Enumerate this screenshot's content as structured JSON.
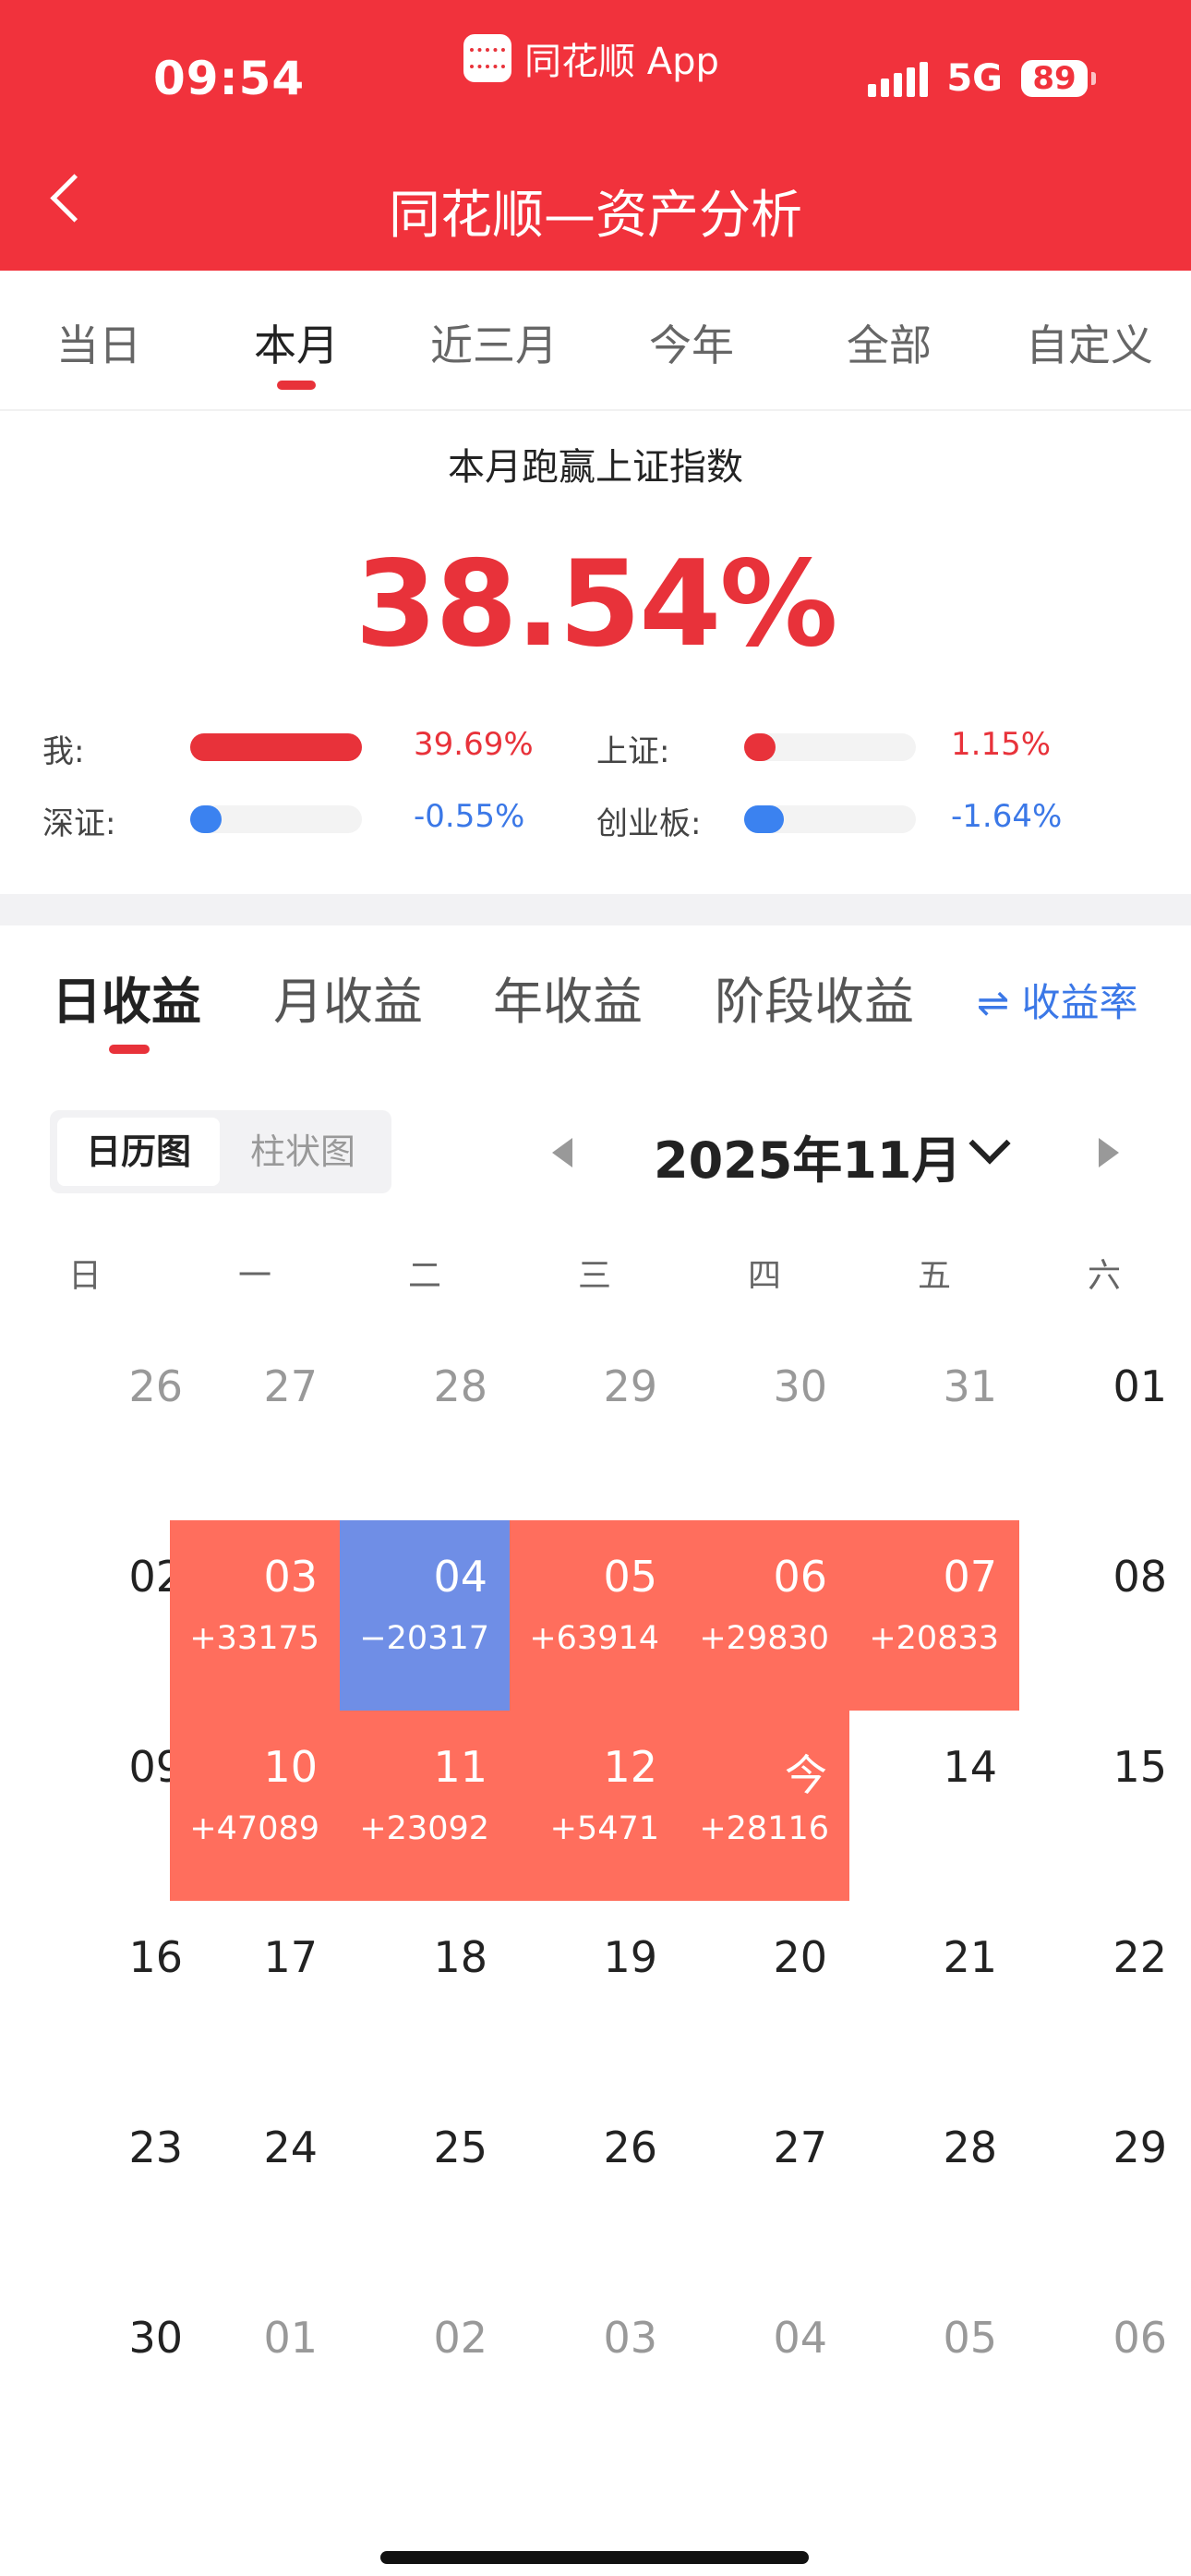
{
  "status_bar": {
    "time": "09:54",
    "app_name": "同花顺 App",
    "network": "5G",
    "battery": "89"
  },
  "header": {
    "title": "同花顺—资产分析"
  },
  "period_tabs": [
    {
      "label": "当日",
      "active": false
    },
    {
      "label": "本月",
      "active": true
    },
    {
      "label": "近三月",
      "active": false
    },
    {
      "label": "今年",
      "active": false
    },
    {
      "label": "全部",
      "active": false
    },
    {
      "label": "自定义",
      "active": false
    }
  ],
  "summary": {
    "title": "本月跑赢上证指数",
    "value": "38.54%",
    "comparisons": [
      {
        "label": "我:",
        "value": "39.69%",
        "fill": 1.0,
        "color": "#e8323a"
      },
      {
        "label": "上证:",
        "value": "1.15%",
        "fill": 0.18,
        "color": "#e8323a"
      },
      {
        "label": "深证:",
        "value": "-0.55%",
        "fill": 0.12,
        "color": "#3b82f0"
      },
      {
        "label": "创业板:",
        "value": "-1.64%",
        "fill": 0.23,
        "color": "#3b82f0"
      }
    ]
  },
  "return_tabs": [
    {
      "label": "日收益",
      "active": true
    },
    {
      "label": "月收益",
      "active": false
    },
    {
      "label": "年收益",
      "active": false
    },
    {
      "label": "阶段收益",
      "active": false
    }
  ],
  "rate_link": "⇌ 收益率",
  "view_toggle": {
    "calendar": "日历图",
    "bar": "柱状图"
  },
  "month_label": "2025年11月",
  "weekdays": [
    "日",
    "一",
    "二",
    "三",
    "四",
    "五",
    "六"
  ],
  "calendar": [
    [
      {
        "day": "26",
        "muted": true
      },
      {
        "day": "27",
        "muted": true
      },
      {
        "day": "28",
        "muted": true
      },
      {
        "day": "29",
        "muted": true
      },
      {
        "day": "30",
        "muted": true
      },
      {
        "day": "31",
        "muted": true
      },
      {
        "day": "01"
      }
    ],
    [
      {
        "day": "02"
      },
      {
        "day": "03",
        "amount": "+33175",
        "type": "up"
      },
      {
        "day": "04",
        "amount": "−20317",
        "type": "down"
      },
      {
        "day": "05",
        "amount": "+63914",
        "type": "up"
      },
      {
        "day": "06",
        "amount": "+29830",
        "type": "up"
      },
      {
        "day": "07",
        "amount": "+20833",
        "type": "up"
      },
      {
        "day": "08"
      }
    ],
    [
      {
        "day": "09"
      },
      {
        "day": "10",
        "amount": "+47089",
        "type": "up"
      },
      {
        "day": "11",
        "amount": "+23092",
        "type": "up"
      },
      {
        "day": "12",
        "amount": "+5471",
        "type": "up"
      },
      {
        "day": "今",
        "amount": "+28116",
        "type": "up"
      },
      {
        "day": "14"
      },
      {
        "day": "15"
      }
    ],
    [
      {
        "day": "16"
      },
      {
        "day": "17"
      },
      {
        "day": "18"
      },
      {
        "day": "19"
      },
      {
        "day": "20"
      },
      {
        "day": "21"
      },
      {
        "day": "22"
      }
    ],
    [
      {
        "day": "23"
      },
      {
        "day": "24"
      },
      {
        "day": "25"
      },
      {
        "day": "26"
      },
      {
        "day": "27"
      },
      {
        "day": "28"
      },
      {
        "day": "29"
      }
    ],
    [
      {
        "day": "30"
      },
      {
        "day": "01",
        "muted": true
      },
      {
        "day": "02",
        "muted": true
      },
      {
        "day": "03",
        "muted": true
      },
      {
        "day": "04",
        "muted": true
      },
      {
        "day": "05",
        "muted": true
      },
      {
        "day": "06",
        "muted": true
      }
    ]
  ]
}
